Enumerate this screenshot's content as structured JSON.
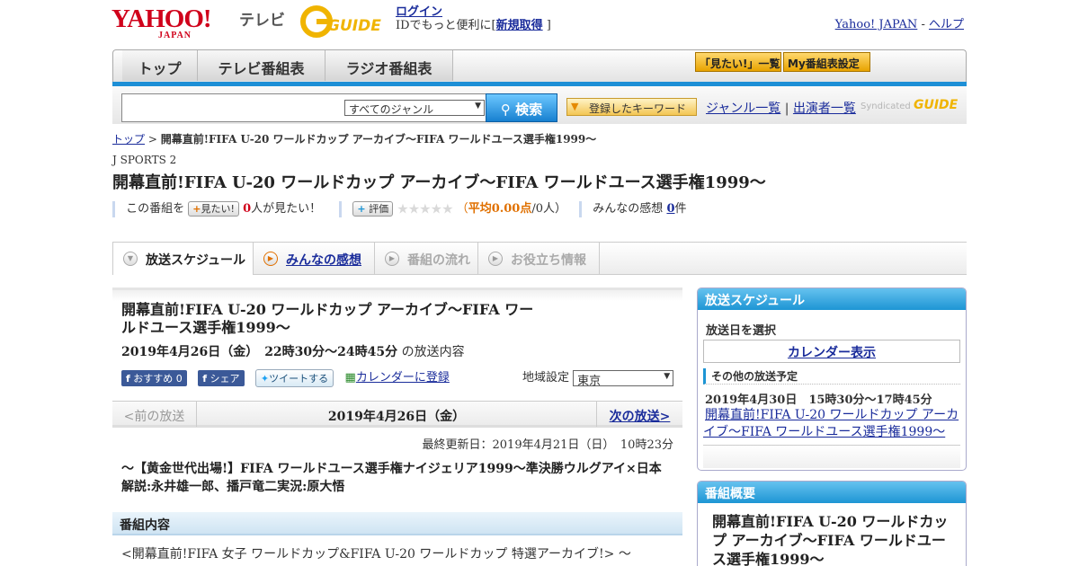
{
  "header": {
    "yahoo_logo": "YAHOO!",
    "yahoo_sub": "JAPAN",
    "tv_label": "テレビ",
    "gguide_logo": "GUIDE",
    "login_link": "ログイン",
    "login_text": "IDでもっと便利に[",
    "signup_link": "新規取得",
    "login_close": "]",
    "yahoo_japan_link": "Yahoo! JAPAN",
    "separator": "-",
    "help_link": "ヘルプ"
  },
  "nav": {
    "tabs": [
      "トップ",
      "テレビ番組表",
      "ラジオ番組表"
    ],
    "mitai_list": "「見たい!」一覧",
    "my_schedule": "My番組表設定"
  },
  "search": {
    "placeholder": "",
    "genre_selected": "すべてのジャンル",
    "button_label": "検索",
    "keyword_button": "登録したキーワード",
    "genre_list_link": "ジャンル一覧",
    "divider": "|",
    "performer_link": "出演者一覧",
    "syndicated": "Syndicated"
  },
  "breadcrumb": {
    "top": "トップ",
    "sep": ">",
    "current": "開幕直前!FIFA U-20 ワールドカップ アーカイブ～FIFA ワールドユース選手権1999～"
  },
  "program": {
    "channel": "J SPORTS 2",
    "title": "開幕直前!FIFA U-20 ワールドカップ アーカイブ～FIFA ワールドユース選手権1999～",
    "this_program": "この番組を",
    "mitai_btn": "見たい!",
    "mitai_count": "0",
    "mitai_suffix": "人が見たい！",
    "rate_btn": "評価",
    "stars": "★★★★★",
    "avg_open": "（",
    "avg_label": "平均0.00点",
    "avg_people": "/0人）",
    "impressions_label": "みんなの感想",
    "impressions_count": "0",
    "impressions_suffix": "件"
  },
  "tabs": [
    {
      "label": "放送スケジュール",
      "active": true
    },
    {
      "label": "みんなの感想",
      "link": true
    },
    {
      "label": "番組の流れ"
    },
    {
      "label": "お役立ち情報"
    }
  ],
  "detail": {
    "title": "開幕直前!FIFA U-20 ワールドカップ アーカイブ～FIFA ワールドユース選手権1999～",
    "date_time": "2019年4月26日（金）　22時30分～24時45分",
    "date_suffix": "の放送内容",
    "fb_recommend": "おすすめ 0",
    "fb_share": "シェア",
    "tweet": "ツイートする",
    "calendar_register": "カレンダーに登録",
    "region_label": "地域設定",
    "region_value": "東京",
    "prev_broadcast": "<前の放送",
    "broadcast_date": "2019年4月26日（金）",
    "next_broadcast": "次の放送>",
    "updated": "最終更新日：2019年4月21日（日）　10時23分",
    "summary": "～【黄金世代出場!】FIFA ワールドユース選手権ナイジェリア1999～準決勝ウルグアイ×日本解説:永井雄一郎、播戸竜二実況:原大悟",
    "content_heading": "番組内容",
    "content_text": "<開幕直前!FIFA 女子 ワールドカップ&FIFA U-20 ワールドカップ 特選アーカイブ!> ～"
  },
  "sidebar": {
    "schedule_heading": "放送スケジュール",
    "select_date": "放送日を選択",
    "calendar_btn": "カレンダー表示",
    "other_label": "その他の放送予定",
    "other_date": "2019年4月30日　15時30分～17時45分",
    "other_link": "開幕直前!FIFA U-20 ワールドカップ アーカイブ～FIFA ワールドユース選手権1999～",
    "summary_heading": "番組概要",
    "summary_title": "開幕直前!FIFA U-20 ワールドカップ アーカイブ～FIFA ワールドユース選手権1999～"
  }
}
